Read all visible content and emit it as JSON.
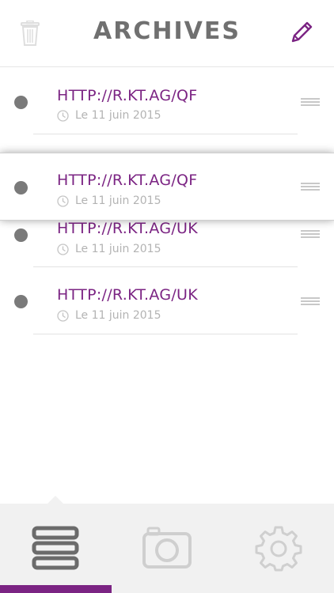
{
  "header": {
    "title": "ARCHIVES",
    "left_icon": "trash-icon",
    "right_icon": "pencil-icon"
  },
  "items": [
    {
      "url": "HTTP://R.KT.AG/QF",
      "date": "Le 11 juin 2015"
    },
    {
      "url": "HTTP://R.KT.AG/QF",
      "date": "Le 11 juin 2015"
    },
    {
      "url": "HTTP://R.KT.AG/UK",
      "date": "Le 11 juin 2015"
    },
    {
      "url": "HTTP://R.KT.AG/UK",
      "date": "Le 11 juin 2015"
    }
  ],
  "tabs": [
    {
      "icon": "list-icon",
      "active": true
    },
    {
      "icon": "camera-icon",
      "active": false
    },
    {
      "icon": "gear-icon",
      "active": false
    }
  ],
  "colors": {
    "accent": "#7b2483",
    "title": "#707070",
    "inactive_icon": "#cfcfcf",
    "active_icon": "#6b6b6b"
  }
}
